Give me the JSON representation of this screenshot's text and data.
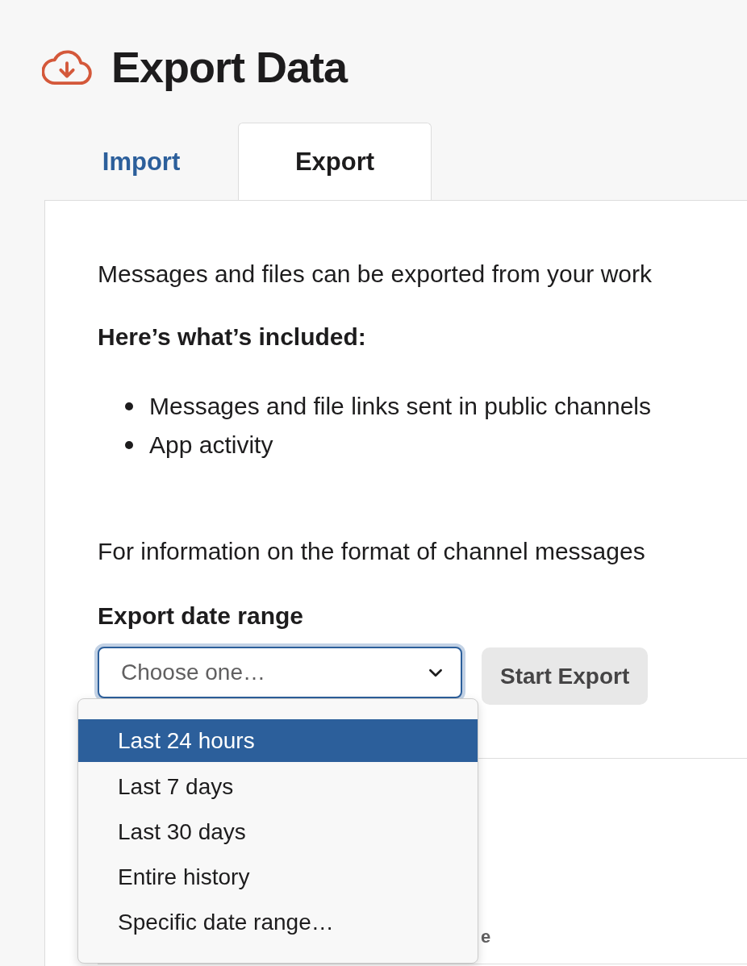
{
  "header": {
    "title": "Export Data"
  },
  "tabs": [
    {
      "label": "Import",
      "selected": false
    },
    {
      "label": "Export",
      "selected": true
    }
  ],
  "intro": "Messages and files can be exported from your work",
  "included_heading": "Here’s what’s included:",
  "included_items": [
    "Messages and file links sent in public channels",
    "App activity"
  ],
  "format_note": "For information on the format of channel messages",
  "date_range": {
    "label": "Export date range",
    "placeholder": "Choose one…",
    "expanded": true,
    "options": [
      {
        "label": "Last 24 hours",
        "selected": true
      },
      {
        "label": "Last 7 days",
        "selected": false
      },
      {
        "label": "Last 30 days",
        "selected": false
      },
      {
        "label": "Entire history",
        "selected": false
      },
      {
        "label": "Specific date range…",
        "selected": false
      }
    ]
  },
  "start_button": "Start Export",
  "section_text": "e"
}
